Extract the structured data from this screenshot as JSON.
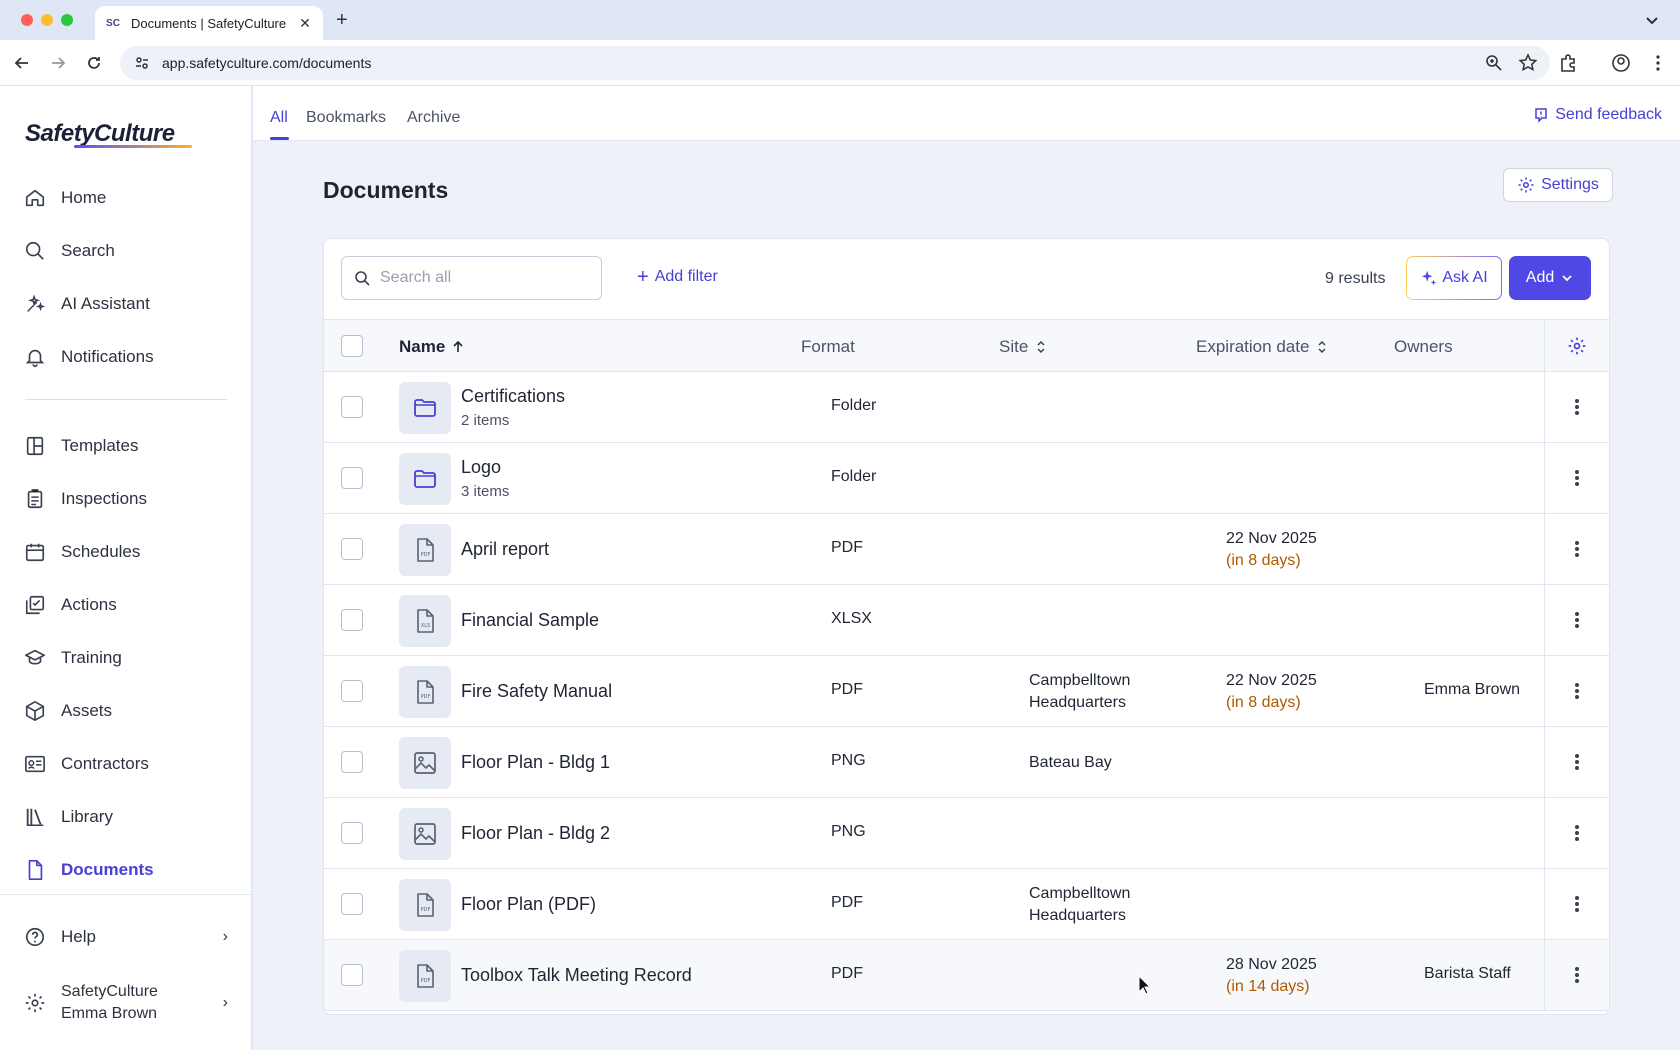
{
  "browser": {
    "tab_title": "Documents | SafetyCulture",
    "favicon_text": "SC",
    "url": "app.safetyculture.com/documents"
  },
  "sidebar": {
    "logo": "SafetyCulture",
    "items": [
      {
        "label": "Home",
        "icon": "home-icon"
      },
      {
        "label": "Search",
        "icon": "search-icon"
      },
      {
        "label": "AI Assistant",
        "icon": "ai-sparkle-icon"
      },
      {
        "label": "Notifications",
        "icon": "bell-icon"
      },
      {
        "label": "Templates",
        "icon": "template-icon"
      },
      {
        "label": "Inspections",
        "icon": "clipboard-icon"
      },
      {
        "label": "Schedules",
        "icon": "calendar-icon"
      },
      {
        "label": "Actions",
        "icon": "checklist-icon"
      },
      {
        "label": "Training",
        "icon": "graduation-cap-icon"
      },
      {
        "label": "Assets",
        "icon": "cube-icon"
      },
      {
        "label": "Contractors",
        "icon": "id-card-icon"
      },
      {
        "label": "Library",
        "icon": "books-icon"
      },
      {
        "label": "Documents",
        "icon": "document-icon"
      }
    ],
    "help_label": "Help",
    "account_org": "SafetyCulture",
    "account_user": "Emma Brown"
  },
  "topnav": {
    "tabs": [
      "All",
      "Bookmarks",
      "Archive"
    ],
    "active_tab": "All",
    "feedback_label": "Send feedback"
  },
  "page": {
    "title": "Documents",
    "settings_label": "Settings",
    "search_placeholder": "Search all",
    "add_filter_label": "Add filter",
    "results_label": "9 results",
    "ask_ai_label": "Ask AI",
    "add_label": "Add"
  },
  "table": {
    "columns": {
      "name": "Name",
      "format": "Format",
      "site": "Site",
      "expiration": "Expiration date",
      "owners": "Owners"
    },
    "rows": [
      {
        "name": "Certifications",
        "sub": "2 items",
        "format": "Folder",
        "site1": "",
        "site2": "",
        "exp_date": "",
        "exp_rel": "",
        "owner": "",
        "icon": "folder-icon"
      },
      {
        "name": "Logo",
        "sub": "3 items",
        "format": "Folder",
        "site1": "",
        "site2": "",
        "exp_date": "",
        "exp_rel": "",
        "owner": "",
        "icon": "folder-icon"
      },
      {
        "name": "April report",
        "sub": "",
        "format": "PDF",
        "site1": "",
        "site2": "",
        "exp_date": "22 Nov 2025",
        "exp_rel": "(in 8 days)",
        "owner": "",
        "icon": "pdf-file-icon"
      },
      {
        "name": "Financial Sample",
        "sub": "",
        "format": "XLSX",
        "site1": "",
        "site2": "",
        "exp_date": "",
        "exp_rel": "",
        "owner": "",
        "icon": "xls-file-icon"
      },
      {
        "name": "Fire Safety Manual",
        "sub": "",
        "format": "PDF",
        "site1": "Campbelltown",
        "site2": "Headquarters",
        "exp_date": "22 Nov 2025",
        "exp_rel": "(in 8 days)",
        "owner": "Emma Brown",
        "icon": "pdf-file-icon"
      },
      {
        "name": "Floor Plan - Bldg 1",
        "sub": "",
        "format": "PNG",
        "site1": "Bateau Bay",
        "site2": "",
        "exp_date": "",
        "exp_rel": "",
        "owner": "",
        "icon": "image-icon"
      },
      {
        "name": "Floor Plan - Bldg 2",
        "sub": "",
        "format": "PNG",
        "site1": "",
        "site2": "",
        "exp_date": "",
        "exp_rel": "",
        "owner": "",
        "icon": "image-icon"
      },
      {
        "name": "Floor Plan (PDF)",
        "sub": "",
        "format": "PDF",
        "site1": "Campbelltown",
        "site2": "Headquarters",
        "exp_date": "",
        "exp_rel": "",
        "owner": "",
        "icon": "pdf-file-icon"
      },
      {
        "name": "Toolbox Talk Meeting Record",
        "sub": "",
        "format": "PDF",
        "site1": "",
        "site2": "",
        "exp_date": "28 Nov 2025",
        "exp_rel": "(in 14 days)",
        "owner": "Barista Staff",
        "icon": "pdf-file-icon"
      }
    ]
  },
  "colors": {
    "accent": "#4740d4",
    "primary_button": "#5048e5",
    "expiry_warning": "#b05a00"
  }
}
